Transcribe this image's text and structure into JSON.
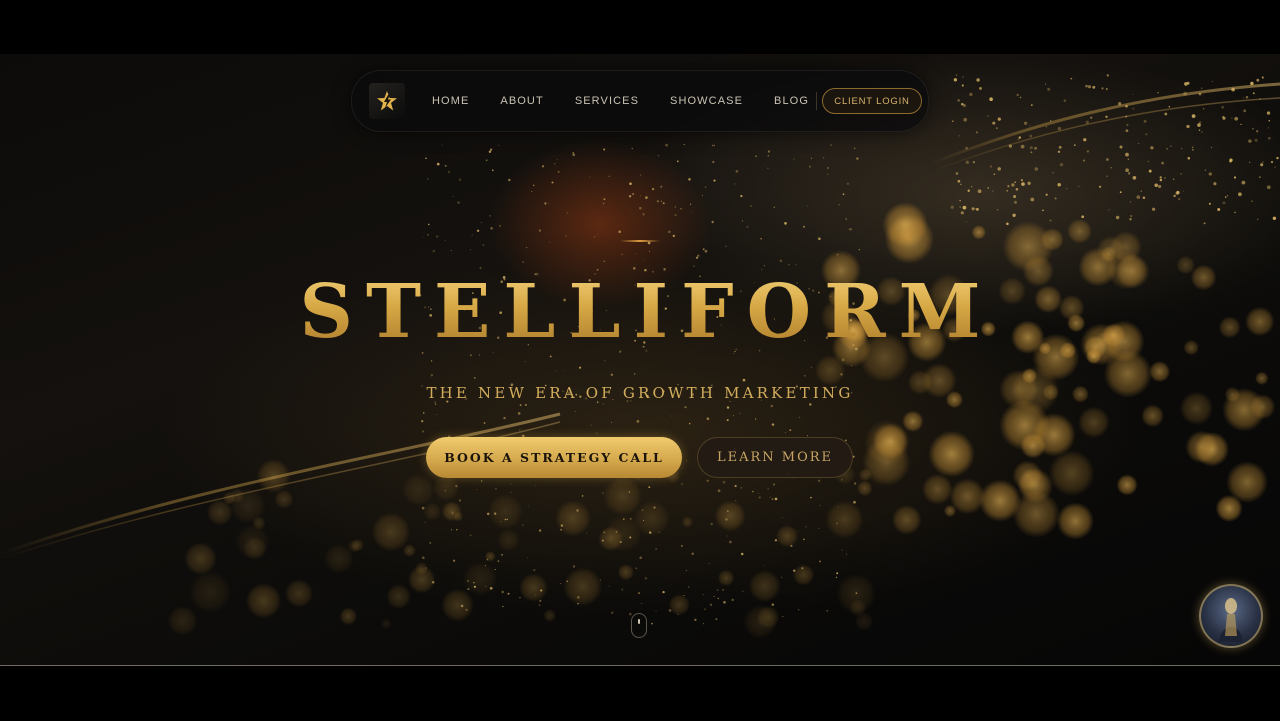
{
  "nav": {
    "logo_icon": "star-bolt-icon",
    "links": [
      {
        "label": "HOME"
      },
      {
        "label": "ABOUT"
      },
      {
        "label": "SERVICES"
      },
      {
        "label": "SHOWCASE"
      },
      {
        "label": "BLOG"
      }
    ],
    "client_login_label": "CLIENT LOGIN"
  },
  "hero": {
    "title": "STELLIFORM",
    "tagline": "THE NEW ERA OF GROWTH MARKETING",
    "primary_cta": "BOOK A STRATEGY CALL",
    "secondary_cta": "LEARN MORE",
    "scroll_icon": "mouse-scroll-icon"
  },
  "chat_widget": {
    "icon": "assistant-avatar-icon"
  },
  "colors": {
    "gold": "#d9ae4b",
    "gold_light": "#f0cb6e",
    "background": "#0c0b0a",
    "nav_text": "#c9c2b4"
  }
}
